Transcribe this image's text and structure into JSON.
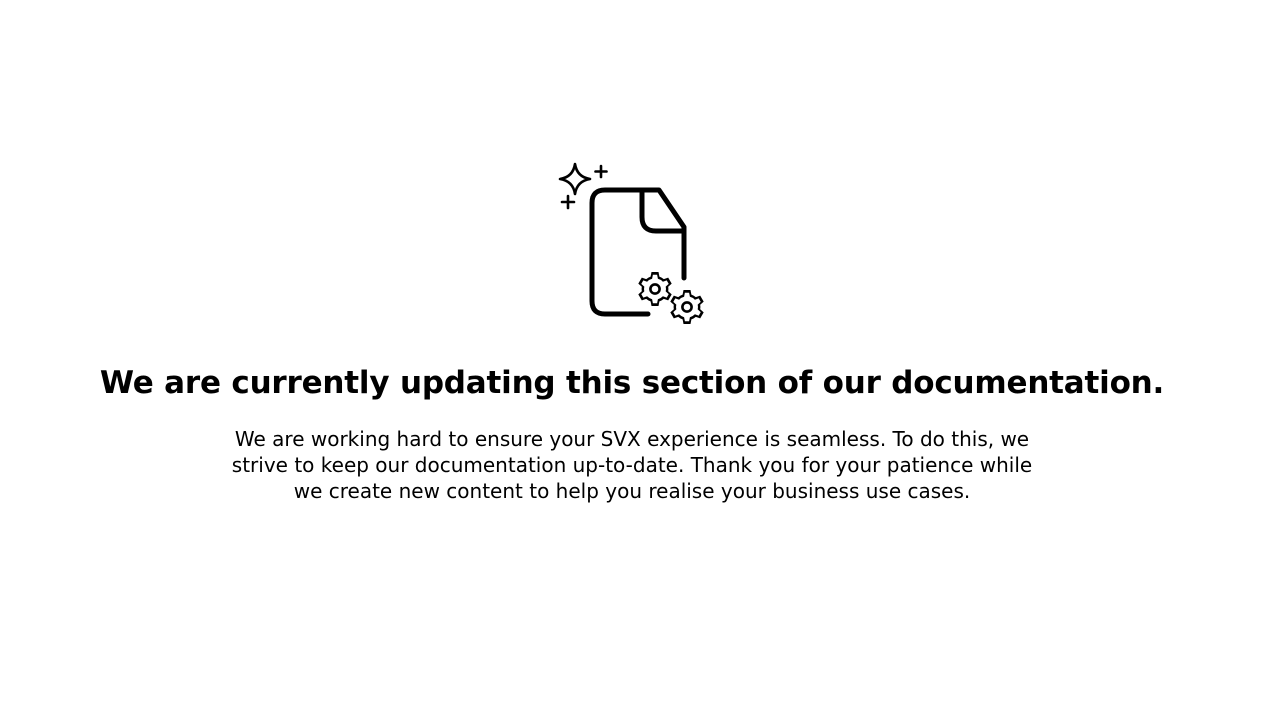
{
  "illustration": {
    "icon": "document-sparkle-gears-icon",
    "color": "#000000"
  },
  "content": {
    "heading": "We are currently updating this section of our documentation.",
    "description": "We are working hard to ensure your SVX experience is seamless. To do this, we strive to keep our documentation up-to-date. Thank you for your patience while we create new content to help you realise your business use cases."
  },
  "colors": {
    "background": "#ffffff",
    "text": "#000000"
  }
}
